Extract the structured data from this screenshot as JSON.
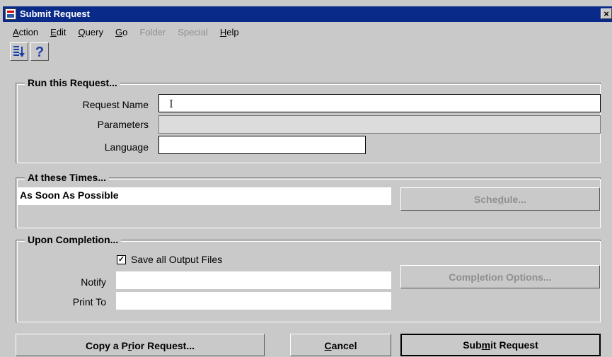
{
  "window": {
    "title": "Submit Request",
    "close": "×"
  },
  "menu": [
    {
      "label": "Action",
      "mnemonic": "A"
    },
    {
      "label": "Edit",
      "mnemonic": "E"
    },
    {
      "label": "Query",
      "mnemonic": "Q"
    },
    {
      "label": "Go",
      "mnemonic": "G"
    },
    {
      "label": "Folder",
      "mnemonic": "",
      "disabled": true
    },
    {
      "label": "Special",
      "mnemonic": "",
      "disabled": true
    },
    {
      "label": "Help",
      "mnemonic": "H"
    }
  ],
  "toolbar": {
    "icons": [
      "list-sort-icon",
      "help-question-icon"
    ]
  },
  "run_group": {
    "title": "Run this Request...",
    "request_name_label": "Request Name",
    "request_name_value": "",
    "parameters_label": "Parameters",
    "parameters_value": "",
    "language_label": "Language",
    "language_value": ""
  },
  "times_group": {
    "title": "At these Times...",
    "value": "As Soon As Possible",
    "schedule_button": "Schedule..."
  },
  "completion_group": {
    "title": "Upon Completion...",
    "save_output_label": "Save all Output Files",
    "save_output_checked": true,
    "checkmark": "✓",
    "notify_label": "Notify",
    "notify_value": "",
    "print_to_label": "Print To",
    "print_to_value": "",
    "options_button": "Completion Options..."
  },
  "footer": {
    "copy_button": "Copy a Prior Request...",
    "cancel_button": "Cancel",
    "submit_button": "Submit Request"
  },
  "colors": {
    "title_bar": "#0a2a8a",
    "background": "#c9c9c9",
    "disabled_text": "#8f8f8f"
  }
}
